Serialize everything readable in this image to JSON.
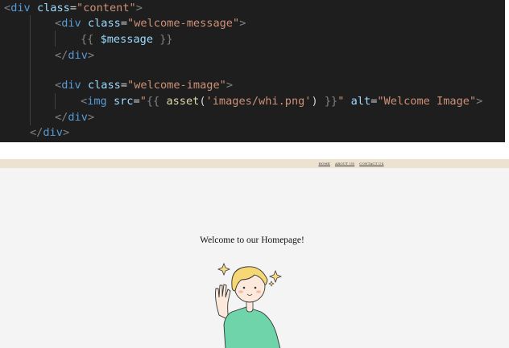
{
  "editor": {
    "lines": [
      [
        {
          "c": "c-punc",
          "t": "<"
        },
        {
          "c": "c-tag",
          "t": "div"
        },
        {
          "c": "c-text",
          "t": " "
        },
        {
          "c": "c-attr",
          "t": "class"
        },
        {
          "c": "c-text",
          "t": "="
        },
        {
          "c": "c-str",
          "t": "\"content\""
        },
        {
          "c": "c-punc",
          "t": ">"
        }
      ],
      [
        {
          "c": "c-punc",
          "t": "<"
        },
        {
          "c": "c-tag",
          "t": "div"
        },
        {
          "c": "c-text",
          "t": " "
        },
        {
          "c": "c-attr",
          "t": "class"
        },
        {
          "c": "c-text",
          "t": "="
        },
        {
          "c": "c-str",
          "t": "\"welcome-message\""
        },
        {
          "c": "c-punc",
          "t": ">"
        }
      ],
      [
        {
          "c": "c-punc",
          "t": "{{ "
        },
        {
          "c": "c-var",
          "t": "$message"
        },
        {
          "c": "c-punc",
          "t": " }}"
        }
      ],
      [
        {
          "c": "c-punc",
          "t": "</"
        },
        {
          "c": "c-tag",
          "t": "div"
        },
        {
          "c": "c-punc",
          "t": ">"
        }
      ],
      [],
      [
        {
          "c": "c-punc",
          "t": "<"
        },
        {
          "c": "c-tag",
          "t": "div"
        },
        {
          "c": "c-text",
          "t": " "
        },
        {
          "c": "c-attr",
          "t": "class"
        },
        {
          "c": "c-text",
          "t": "="
        },
        {
          "c": "c-str",
          "t": "\"welcome-image\""
        },
        {
          "c": "c-punc",
          "t": ">"
        }
      ],
      [
        {
          "c": "c-punc",
          "t": "<"
        },
        {
          "c": "c-tag",
          "t": "img"
        },
        {
          "c": "c-text",
          "t": " "
        },
        {
          "c": "c-attr",
          "t": "src"
        },
        {
          "c": "c-text",
          "t": "="
        },
        {
          "c": "c-str",
          "t": "\""
        },
        {
          "c": "c-punc",
          "t": "{{ "
        },
        {
          "c": "c-fn",
          "t": "asset"
        },
        {
          "c": "c-text",
          "t": "("
        },
        {
          "c": "c-str",
          "t": "'images/whi.png'"
        },
        {
          "c": "c-text",
          "t": ")"
        },
        {
          "c": "c-punc",
          "t": " }}"
        },
        {
          "c": "c-str",
          "t": "\""
        },
        {
          "c": "c-text",
          "t": " "
        },
        {
          "c": "c-attr",
          "t": "alt"
        },
        {
          "c": "c-text",
          "t": "="
        },
        {
          "c": "c-str",
          "t": "\"Welcome Image\""
        },
        {
          "c": "c-punc",
          "t": ">"
        }
      ],
      [
        {
          "c": "c-punc",
          "t": "</"
        },
        {
          "c": "c-tag",
          "t": "div"
        },
        {
          "c": "c-punc",
          "t": ">"
        }
      ],
      [
        {
          "c": "c-punc",
          "t": "</"
        },
        {
          "c": "c-tag",
          "t": "div"
        },
        {
          "c": "c-punc",
          "t": ">"
        }
      ]
    ]
  },
  "preview": {
    "nav_links": [
      "HOME",
      "ABOUT US",
      "CONTACT US"
    ],
    "welcome_text": "Welcome to our Homepage!"
  },
  "colors": {
    "editor_bg": "#1e1e1e",
    "navbar_bg": "#ede2d0",
    "page_bg": "#f4f4f4",
    "shirt": "#6fd4a9",
    "hair": "#f7d774"
  },
  "icons": [
    "sparkle-icon",
    "waving-boy-illustration"
  ]
}
